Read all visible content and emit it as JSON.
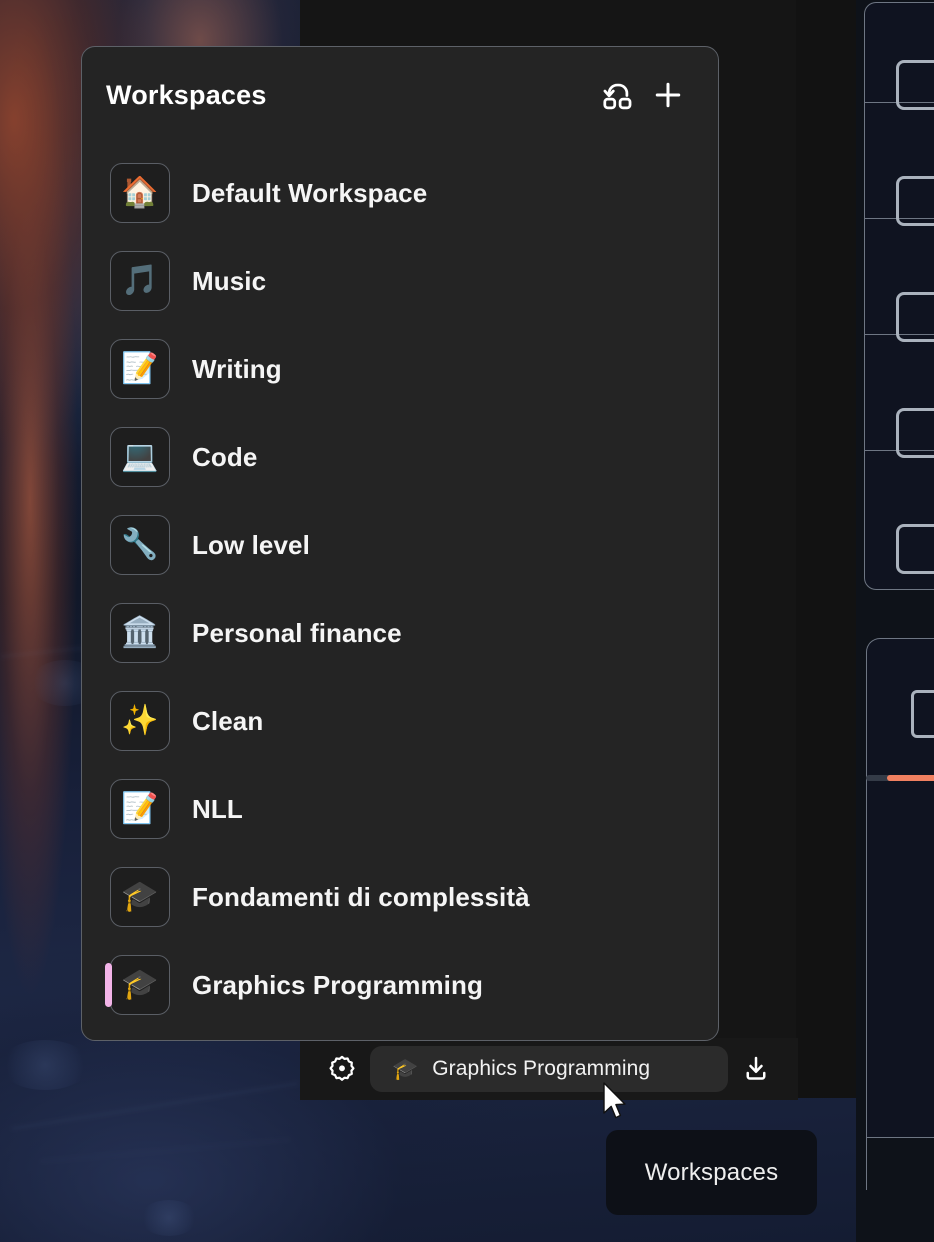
{
  "panel": {
    "title": "Workspaces",
    "actions": [
      {
        "name": "switch-workspace-icon",
        "label": "Switch workspace"
      },
      {
        "name": "add-workspace-icon",
        "label": "Add workspace"
      }
    ],
    "items": [
      {
        "emoji": "🏠",
        "icon_name": "house-emoji",
        "label": "Default Workspace",
        "active": false
      },
      {
        "emoji": "🎵",
        "icon_name": "musical-note-emoji",
        "label": "Music",
        "active": false
      },
      {
        "emoji": "📝",
        "icon_name": "memo-emoji",
        "label": "Writing",
        "active": false
      },
      {
        "emoji": "💻",
        "icon_name": "laptop-emoji",
        "label": "Code",
        "active": false
      },
      {
        "emoji": "🔧",
        "icon_name": "wrench-emoji",
        "label": "Low level",
        "active": false
      },
      {
        "emoji": "🏛️",
        "icon_name": "classical-building-emoji",
        "label": "Personal finance",
        "active": false
      },
      {
        "emoji": "✨",
        "icon_name": "sparkles-emoji",
        "label": "Clean",
        "active": false
      },
      {
        "emoji": "📝",
        "icon_name": "memo-emoji",
        "label": "NLL",
        "active": false
      },
      {
        "emoji": "🎓",
        "icon_name": "graduation-cap-emoji",
        "label": "Fondamenti di complessità",
        "active": false
      },
      {
        "emoji": "🎓",
        "icon_name": "graduation-cap-emoji",
        "label": "Graphics Programming",
        "active": true
      }
    ]
  },
  "bottom_bar": {
    "settings_label": "Settings",
    "download_label": "Download",
    "current_workspace": {
      "emoji": "🎓",
      "label": "Graphics Programming"
    }
  },
  "tooltip": {
    "text": "Workspaces"
  },
  "colors": {
    "panel_background": "#242424",
    "panel_border": "#5d6168",
    "active_indicator": "#f3b4e8",
    "chip_background": "#2b2b2b",
    "bar_background": "#181818",
    "tooltip_background": "#0d1017",
    "progress_accent": "#f08060",
    "text_primary": "#f5f5f5"
  }
}
